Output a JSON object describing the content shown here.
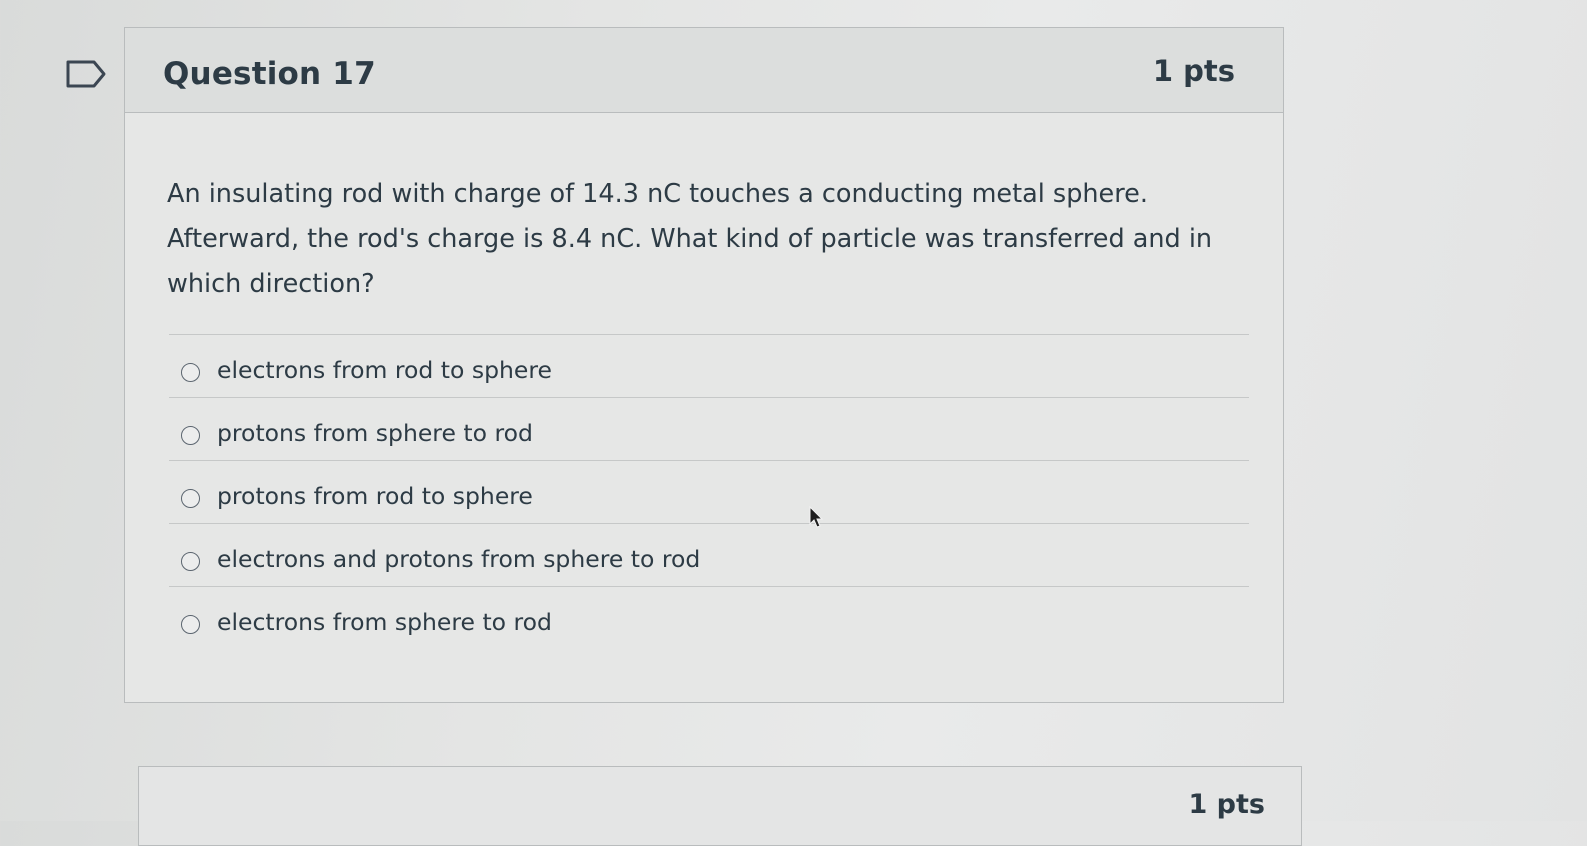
{
  "question": {
    "title": "Question 17",
    "points": "1 pts",
    "text": "An insulating rod with charge of 14.3 nC touches a conducting metal sphere. Afterward, the rod's charge is 8.4 nC. What kind of particle was transferred and in which direction?",
    "answers": [
      {
        "label": "electrons from rod to sphere",
        "selected": false
      },
      {
        "label": "protons from sphere to rod",
        "selected": false
      },
      {
        "label": "protons from rod to sphere",
        "selected": false
      },
      {
        "label": "electrons and protons from sphere to rod",
        "selected": false
      },
      {
        "label": "electrons from sphere to rod",
        "selected": false
      }
    ]
  },
  "next_question": {
    "points": "1 pts"
  },
  "icons": {
    "flag": "flag-bookmark-icon",
    "cursor": "mouse-pointer-icon"
  }
}
